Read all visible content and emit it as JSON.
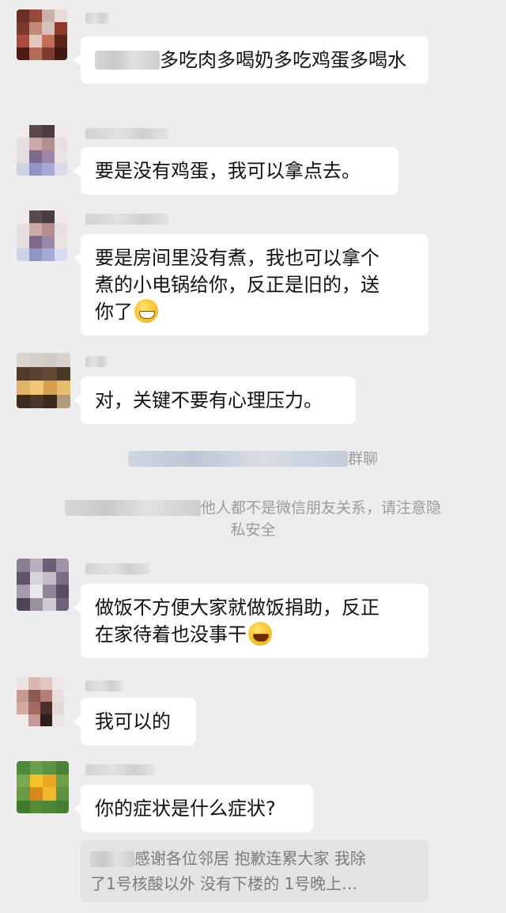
{
  "chat": {
    "messages": [
      {
        "text": "多吃肉多喝奶多吃鸡蛋多喝水"
      },
      {
        "text": "要是没有鸡蛋，我可以拿点去。"
      },
      {
        "line1": "要是房间里没有煮，我也可以拿个",
        "line2": "煮的小电锅给你，反正是旧的，送",
        "line3": "你了"
      },
      {
        "text": "对，关键不要有心理压力。"
      },
      {
        "line1": "做饭不方便大家就做饭捐助，反正",
        "line2": "在家待着也没事干"
      },
      {
        "text": "我可以的"
      },
      {
        "text": "你的症状是什么症状?"
      }
    ],
    "system_notices": [
      {
        "text": "群聊"
      },
      {
        "line1": "他人都不是微信朋友关系，请注意隐",
        "line2": "私安全"
      }
    ],
    "quote": {
      "line1": "感谢各位邻居  抱歉连累大家  我除",
      "line2": "了1号核酸以外  没有下楼的   1号晚上…"
    }
  },
  "icons": [
    "grin-emoji-icon",
    "laugh-cry-emoji-icon"
  ],
  "colors": {
    "background": "#ededed",
    "bubble": "#ffffff",
    "system_text": "#9a9a9a"
  }
}
